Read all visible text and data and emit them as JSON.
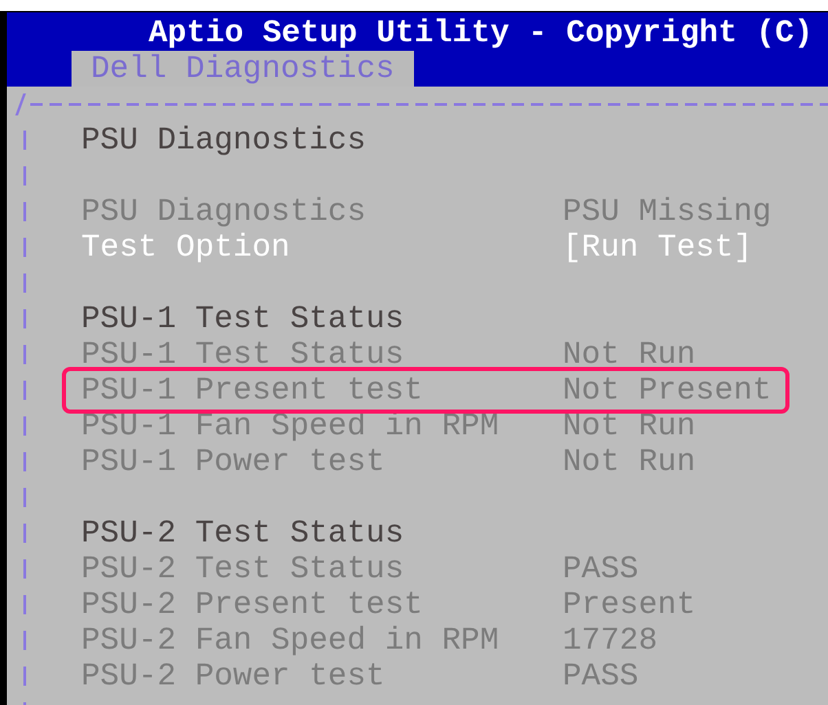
{
  "header": {
    "title": "Aptio Setup Utility - Copyright (C)"
  },
  "tabs": [
    {
      "label": "Dell Diagnostics",
      "selected": true
    }
  ],
  "sections": [
    {
      "title": "PSU Diagnostics"
    },
    {
      "items": [
        {
          "label": "PSU Diagnostics",
          "value": "PSU Missing",
          "kind": "info",
          "highlighted": false
        },
        {
          "label": "Test Option",
          "value": "[Run Test]",
          "kind": "option",
          "highlighted": false
        }
      ]
    },
    {
      "title": "PSU-1 Test Status",
      "items": [
        {
          "label": "PSU-1 Test Status",
          "value": "Not Run",
          "kind": "info",
          "highlighted": false
        },
        {
          "label": "PSU-1 Present test",
          "value": "Not Present",
          "kind": "info",
          "highlighted": true
        },
        {
          "label": "PSU-1 Fan Speed in RPM",
          "value": "Not Run",
          "kind": "info",
          "highlighted": false
        },
        {
          "label": "PSU-1 Power test",
          "value": "Not Run",
          "kind": "info",
          "highlighted": false
        }
      ]
    },
    {
      "title": "PSU-2 Test Status",
      "items": [
        {
          "label": "PSU-2 Test Status",
          "value": "PASS",
          "kind": "info",
          "highlighted": false
        },
        {
          "label": "PSU-2 Present test",
          "value": "Present",
          "kind": "info",
          "highlighted": false
        },
        {
          "label": "PSU-2 Fan Speed in RPM",
          "value": "17728",
          "kind": "info",
          "highlighted": false
        },
        {
          "label": "PSU-2 Power test",
          "value": "PASS",
          "kind": "info",
          "highlighted": false
        }
      ]
    }
  ]
}
